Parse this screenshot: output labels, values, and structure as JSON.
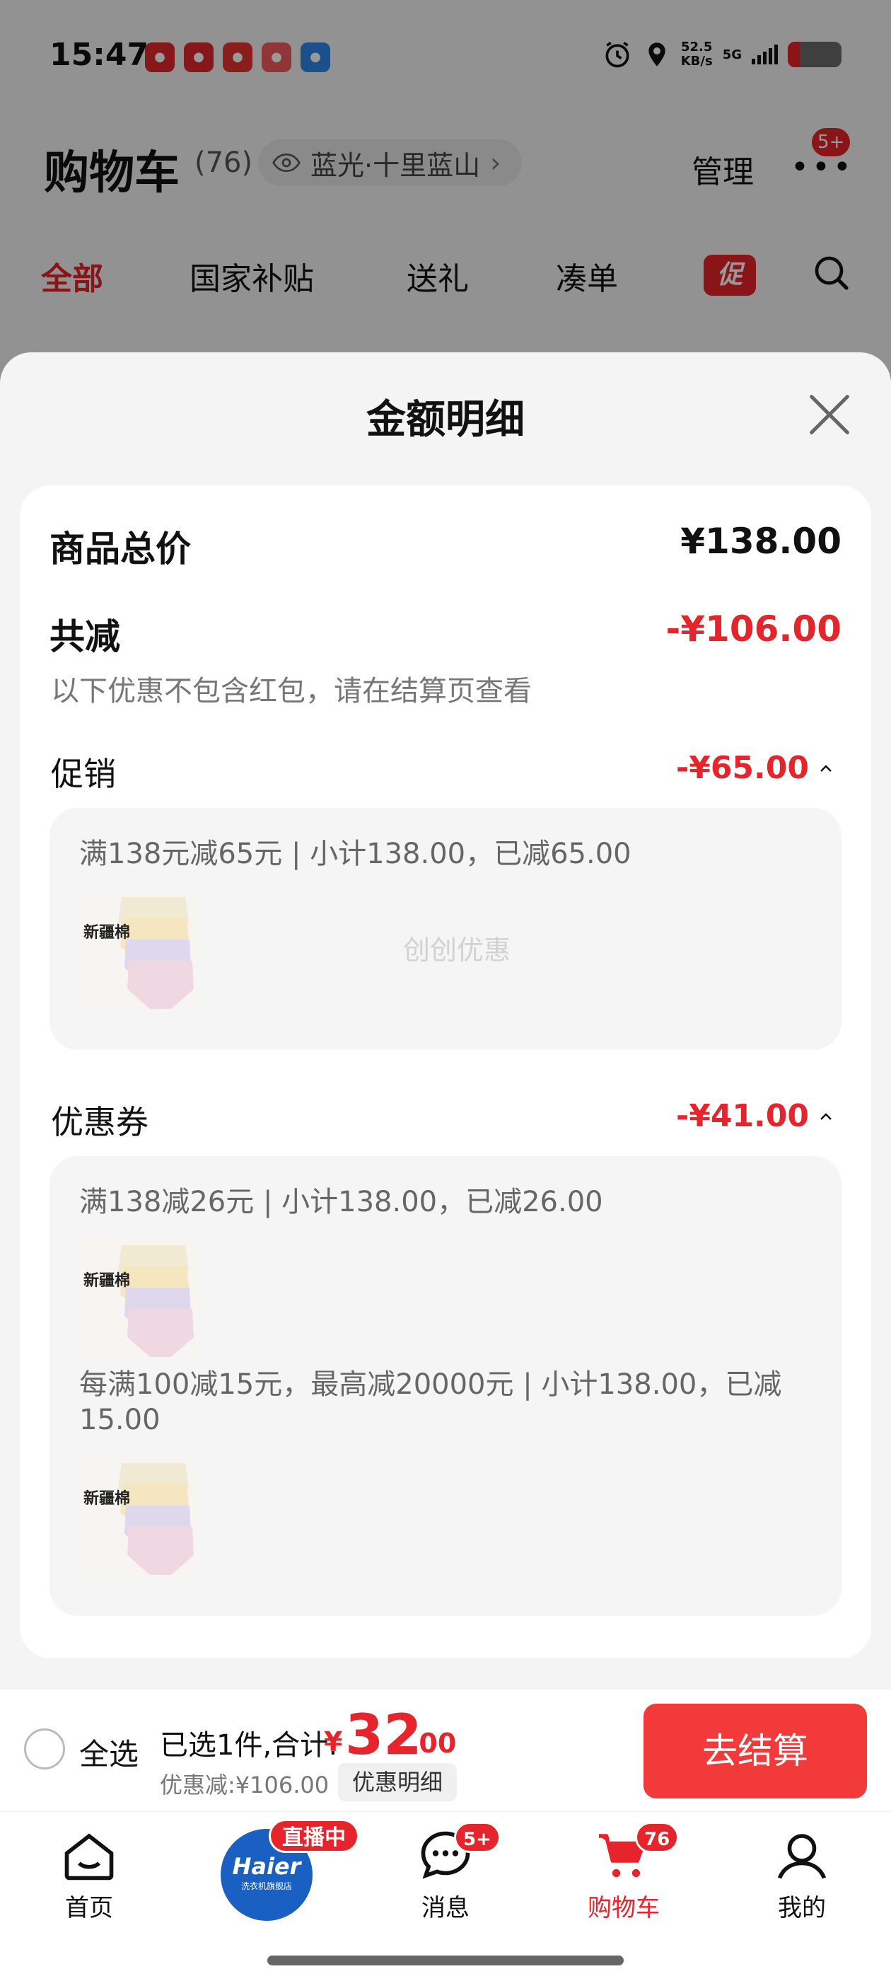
{
  "status_bar": {
    "time": "15:47",
    "net_speed_value": "52.5",
    "net_speed_unit": "KB/s",
    "network": "5G",
    "battery_level": 0.22,
    "accent": "#e5242b"
  },
  "cart_header": {
    "title": "购物车",
    "count": "(76)",
    "address": "蓝光·十里蓝山",
    "manage": "管理",
    "more_badge": "5+"
  },
  "tabs": [
    {
      "label": "全部",
      "active": true
    },
    {
      "label": "国家补贴"
    },
    {
      "label": "送礼"
    },
    {
      "label": "凑单"
    },
    {
      "label": "促"
    }
  ],
  "sheet": {
    "title": "金额明细",
    "total_label": "商品总价",
    "total_value": "¥138.00",
    "reduce_label": "共减",
    "reduce_value": "-¥106.00",
    "reduce_note": "以下优惠不包含红包，请在结算页查看",
    "promo": {
      "label": "促销",
      "amount": "-¥65.00",
      "line": "满138元减65元 | 小计138.00，已减65.00",
      "watermark": "创创优惠"
    },
    "coupon": {
      "label": "优惠券",
      "amount": "-¥41.00",
      "line1": "满138减26元 | 小计138.00，已减26.00",
      "line2": "每满100减15元，最高减20000元 | 小计138.00，已减15.00"
    },
    "thumb_label": "新疆棉"
  },
  "checkout": {
    "select_all": "全选",
    "selected": "已选1件,合计:",
    "currency": "¥",
    "price_int": "32",
    "price_dec": ".00",
    "discount": "优惠减:¥106.00",
    "detail_chip": "优惠明细",
    "button": "去结算"
  },
  "bottom_nav": {
    "home": "首页",
    "live_badge": "直播中",
    "haier_logo": "Haier",
    "haier_shop": "洗衣机旗舰店",
    "messages": "消息",
    "messages_badge": "5+",
    "cart": "购物车",
    "cart_badge": "76",
    "me": "我的"
  }
}
